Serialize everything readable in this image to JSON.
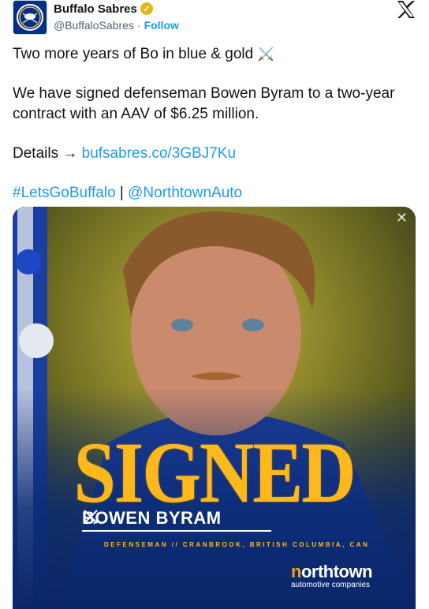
{
  "author": {
    "name": "Buffalo Sabres",
    "handle": "@BuffaloSabres",
    "separator": "·",
    "follow_label": "Follow",
    "verified_icon": "gold-verified-badge-icon"
  },
  "tweet": {
    "line1": "Two more years of Bo in blue & gold",
    "line1_emoji": "⚔️",
    "line2": "We have signed defenseman Bowen Byram to a two-year contract with an AAV of $6.25 million.",
    "details_label": "Details →",
    "details_link": "bufsabres.co/3GBJ7Ku",
    "hashtag": "#LetsGoBuffalo",
    "divider": "|",
    "mention": "@NorthtownAuto"
  },
  "media": {
    "headline": "SIGNED",
    "player_name": "BOWEN BYRAM",
    "player_meta": "DEFENSEMAN  //  CRANBROOK, BRITISH COLUMBIA, CAN",
    "sponsor_name_first": "n",
    "sponsor_name_rest": "orthtown",
    "sponsor_sub": "automotive companies",
    "corner_mark": "✕"
  },
  "colors": {
    "sabres_blue": "#003087",
    "sabres_gold": "#ffb81c",
    "link_blue": "#1d9bf0"
  }
}
